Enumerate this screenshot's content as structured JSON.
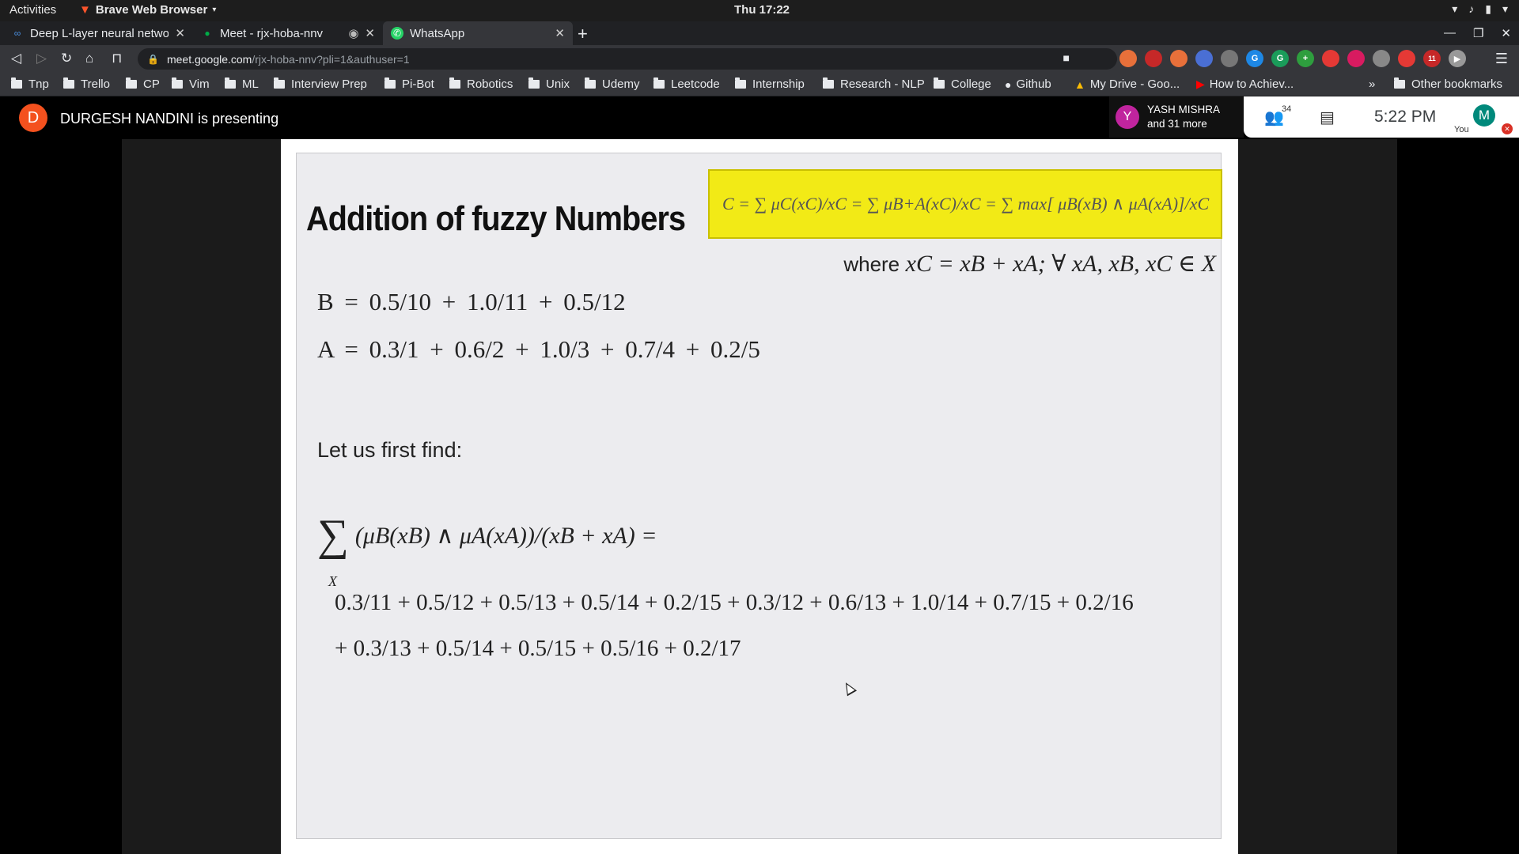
{
  "system": {
    "activities": "Activities",
    "app_name": "Brave Web Browser",
    "clock": "Thu 17:22"
  },
  "tabs": [
    {
      "title": "Deep L-layer neural networ",
      "active": false
    },
    {
      "title": "Meet - rjx-hoba-nnv",
      "active": false
    },
    {
      "title": "WhatsApp",
      "active": true
    }
  ],
  "address_bar": {
    "host": "meet.google.com",
    "path": "/rjx-hoba-nnv?pli=1&authuser=1"
  },
  "extensions": {
    "badge_count": "11",
    "colors": [
      "#e8703a",
      "#4a6fd4",
      "#777777",
      "#1e88e5",
      "#1a9c5a",
      "#2e9e3e",
      "#e53935",
      "#d81b60",
      "#888888",
      "#e53935",
      "#c62828",
      "#999999"
    ]
  },
  "bookmarks": [
    {
      "label": "Tnp",
      "icon": "folder-icon"
    },
    {
      "label": "Trello",
      "icon": "folder-icon"
    },
    {
      "label": "CP",
      "icon": "folder-icon"
    },
    {
      "label": "Vim",
      "icon": "folder-icon"
    },
    {
      "label": "ML",
      "icon": "folder-icon"
    },
    {
      "label": "Interview Prep",
      "icon": "folder-icon"
    },
    {
      "label": "Pi-Bot",
      "icon": "folder-icon"
    },
    {
      "label": "Robotics",
      "icon": "folder-icon"
    },
    {
      "label": "Unix",
      "icon": "folder-icon"
    },
    {
      "label": "Udemy",
      "icon": "folder-icon"
    },
    {
      "label": "Leetcode",
      "icon": "folder-icon"
    },
    {
      "label": "Internship",
      "icon": "folder-icon"
    },
    {
      "label": "Research - NLP",
      "icon": "folder-icon"
    },
    {
      "label": "College",
      "icon": "folder-icon"
    },
    {
      "label": "Github",
      "icon": "github-icon"
    },
    {
      "label": "My Drive - Goo...",
      "icon": "google-drive-icon"
    },
    {
      "label": "How to Achiev...",
      "icon": "youtube-icon"
    }
  ],
  "bookmarks_overflow": "»",
  "other_bookmarks": "Other bookmarks",
  "meet": {
    "presenter_initial": "D",
    "presenting_text": "DURGESH NANDINI is presenting",
    "participant_initial": "Y",
    "participant_name": "YASH MISHRA",
    "participant_more": "and 31 more",
    "people_count": "34",
    "time": "5:22  PM",
    "self_initial": "M",
    "self_label": "You"
  },
  "slide": {
    "title": "Addition of fuzzy Numbers",
    "formula": "C = ∑ μC(xC)/xC = ∑ μB+A(xC)/xC = ∑ max[ μB(xB) ∧ μA(xA)]/xC",
    "where_word": "where",
    "where_condition": "xC = xB + xA; ∀ xA, xB, xC ∈ X",
    "set_B": "B  =  0.5/10  +  1.0/11  +  0.5/12",
    "set_A": "A =  0.3/1  +  0.6/2  +  1.0/3  +  0.7/4  +  0.2/5",
    "intro": "Let us first find:",
    "sum_symbol": "∑",
    "sum_subscript": "X",
    "sum_expression": "(μB(xB) ∧ μA(xA))/(xB + xA) =",
    "result_line_1": "0.3/11 + 0.5/12 + 0.5/13 + 0.5/14 + 0.2/15 + 0.3/12 + 0.6/13 + 1.0/14 + 0.7/15 + 0.2/16",
    "result_line_2": "+ 0.3/13 + 0.5/14 + 0.5/15 + 0.5/16 + 0.2/17"
  },
  "colors": {
    "formula_highlight": "#f2ea16",
    "presenter_avatar": "#f4511e",
    "participant_avatar": "#c0249e",
    "self_avatar": "#00897b"
  }
}
